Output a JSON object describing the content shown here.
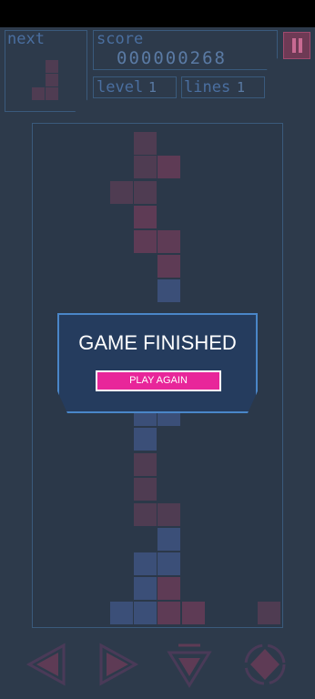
{
  "hud": {
    "next_label": "next",
    "score_label": "score",
    "score_value": "000000268",
    "level_label": "level",
    "level_value": "1",
    "lines_label": "lines",
    "lines_value": "1"
  },
  "modal": {
    "title": "GAME FINISHED",
    "button_label": "PLAY AGAIN"
  },
  "controls": [
    "move-left-icon",
    "move-right-icon",
    "drop-icon",
    "rotate-icon"
  ],
  "colors": {
    "background": "#2d3a4b",
    "accent": "#e8269a",
    "modal_bg": "#253c5e",
    "border": "#3a5a7c"
  }
}
